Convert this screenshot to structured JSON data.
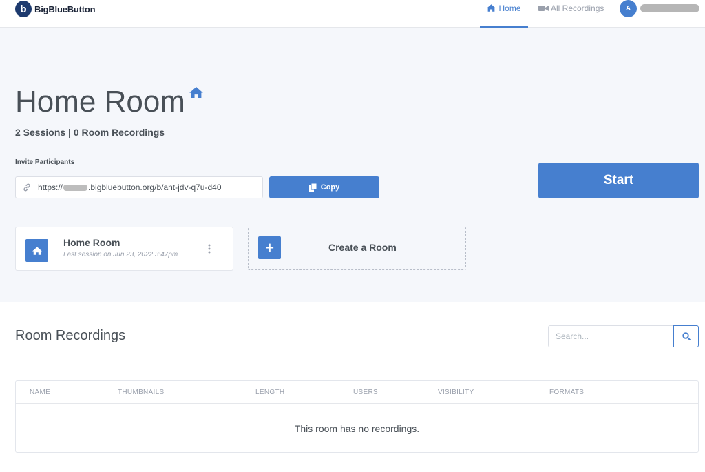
{
  "header": {
    "brand": "BigBlueButton",
    "brand_mark": "b",
    "nav": {
      "home_label": "Home",
      "recordings_label": "All Recordings"
    },
    "avatar_initial": "A"
  },
  "hero": {
    "room_title": "Home Room",
    "sessions_summary": "2 Sessions | 0 Room Recordings",
    "invite_label": "Invite Participants",
    "invite_url_prefix": "https://",
    "invite_url_suffix": ".bigbluebutton.org/b/ant-jdv-q7u-d40",
    "copy_label": "Copy",
    "start_label": "Start"
  },
  "rooms": {
    "home_card": {
      "name": "Home Room",
      "last_session": "Last session on Jun 23, 2022 3:47pm"
    },
    "create_label": "Create a Room",
    "create_symbol": "+"
  },
  "recordings": {
    "title": "Room Recordings",
    "search_placeholder": "Search...",
    "columns": [
      "NAME",
      "THUMBNAILS",
      "LENGTH",
      "USERS",
      "VISIBILITY",
      "FORMATS"
    ],
    "empty_message": "This room has no recordings."
  },
  "colors": {
    "accent": "#467fcf",
    "hero_bg": "#f5f7fb",
    "text": "#495057",
    "muted": "#9aa0ac"
  },
  "icons": [
    "home-icon",
    "video-camera-icon",
    "link-icon",
    "copy-icon",
    "kebab-menu-icon",
    "search-icon"
  ]
}
